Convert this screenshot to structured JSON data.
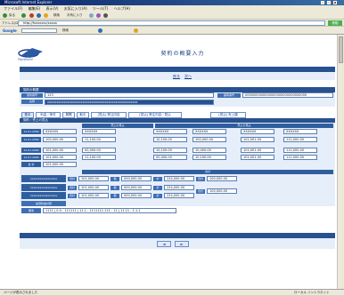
{
  "window": {
    "title": "Microsoft Internet Explorer"
  },
  "menubar": {
    "items": [
      "ファイル(F)",
      "編集(E)",
      "表示(V)",
      "お気に入り(A)",
      "ツール(T)",
      "ヘルプ(H)"
    ]
  },
  "toolbar": {
    "back_label": "戻る",
    "search_label": "検索",
    "favorites_label": "お気に入り"
  },
  "address": {
    "label": "アドレス(D)",
    "value": "http://fxxxxxxx/xxxxx",
    "go_label": "移動"
  },
  "google": {
    "label": "Google",
    "search_btn": "検索"
  },
  "logo": {
    "text": "PayWorld"
  },
  "page": {
    "title": "契約の概要入力"
  },
  "section1": {
    "header": "",
    "links": [
      "戻る",
      "次へ"
    ]
  },
  "section2": {
    "header": "契約の概要",
    "row1_label": "契約番号",
    "row1_value": "123",
    "row1_right_label": "顧客番号",
    "row1_right_value": "0000000000000000000000000000000",
    "row2_label": "名称",
    "row2_value": "xxxxxxxxxxxxxxxxxxxxxxxxxxxxxxxxxxxxxxxxxxxxxxxxx"
  },
  "tabs": [
    "基本",
    "料金／条件",
    "展開",
    "取引",
    "[見込] 受注内容",
    "[見込] 受注内容／見込",
    "[見込] 売上額"
  ],
  "grid": {
    "band_label": "契約 / 売上の見込",
    "col_headers": [
      "",
      "売上の見込",
      "",
      "",
      "売上の見込",
      ""
    ],
    "row_labels": [
      "12.01.2009",
      "12.01.2009",
      "12.01.2009",
      "12.01.2009",
      "合 計"
    ],
    "rows": [
      [
        "XXXXXX",
        "XXXXXX",
        "XXXXXX",
        "XXXXXX",
        "XXXXXX",
        "XXXXXX"
      ],
      [
        "100,000.00",
        "11,100.00",
        "10,100.00",
        "100,000.00",
        "101,001.00",
        "111,000.00"
      ],
      [
        "101,000.00",
        "00,000.00",
        "10,100.00",
        "10,000.00",
        "101,001.00",
        "111,000.00"
      ],
      [
        "101,000.00",
        "11,100.00",
        "00,000.00",
        "10,100.00",
        "101,001.00",
        "111,000.00"
      ],
      [
        "101,000.00",
        "",
        "",
        "",
        "",
        ""
      ]
    ]
  },
  "calc": {
    "header": "合計",
    "rows": [
      {
        "label": "xxxxxxxxxxxxxxxxx",
        "k1": "合計",
        "v1": "101,000.00",
        "k2": "税",
        "v2": "000,000.00",
        "k3": "計",
        "v3": "224,000.00",
        "k4": "合計",
        "v4": "100,000.00"
      },
      {
        "label": "xxxxxxxxxxxxxxxxx",
        "k1": "合計",
        "v1": "101,000.00",
        "k2": "税",
        "v2": "000,000.00",
        "k3": "計",
        "v3": "224,000.00",
        "k4": "",
        "v4": ""
      },
      {
        "label": "xxxxxxxxxxxxxxxxx",
        "k1": "合計",
        "v1": "101,000.00",
        "k2": "税",
        "v2": "000,000.00",
        "k3": "計",
        "v3": "224,000.00",
        "k4": "合計",
        "v4": "100,000.00"
      }
    ],
    "rate_button": "最低料金計算",
    "note_label": "備考",
    "note_value": "1111 | 0.0 - 111111 | 11.1 - 1111111.111 - 11 | 11.11 - 1.1.1"
  },
  "footer_band": "",
  "nav": {
    "prev": "◄",
    "next": "►"
  },
  "status": {
    "left": "ページが表示されました",
    "right": "ローカル イントラネット"
  },
  "colors": {
    "accent": "#27518f",
    "label_bg": "#3e6fb3"
  }
}
